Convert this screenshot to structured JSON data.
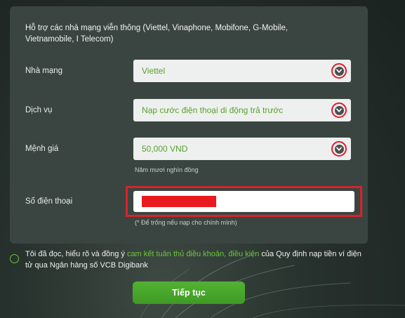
{
  "form": {
    "support_text": "Hỗ trợ các nhà mạng viễn thông (Viettel, Vinaphone, Mobifone, G-Mobile, Vietnamobile, I Telecom)",
    "carrier": {
      "label": "Nhà mạng",
      "value": "Viettel"
    },
    "service": {
      "label": "Dịch vụ",
      "value": "Nạp cước điện thoại di động trả trước"
    },
    "denomination": {
      "label": "Mệnh giá",
      "value": "50,000 VND",
      "hint": "Năm mươi nghìn đồng"
    },
    "phone": {
      "label": "Số điện thoại",
      "value": "",
      "hint": "(* Để trống nếu nạp cho chính mình)"
    }
  },
  "agreement": {
    "text_before": "Tôi đã đọc, hiểu rõ và đồng ý ",
    "link_commit": "cam kết tuân thủ điều khoản",
    "separator": ", ",
    "link_terms": "điều kiện",
    "text_after": " của Quy định nạp tiền ví điện tử qua Ngân hàng số VCB Digibank"
  },
  "actions": {
    "continue_label": "Tiếp tục"
  },
  "colors": {
    "accent_green": "#52b232",
    "highlight_red": "#d7232d",
    "panel": "#3a4541"
  },
  "icons": {
    "dropdown": "chevron-down-icon",
    "radio": "radio-unchecked-icon"
  }
}
